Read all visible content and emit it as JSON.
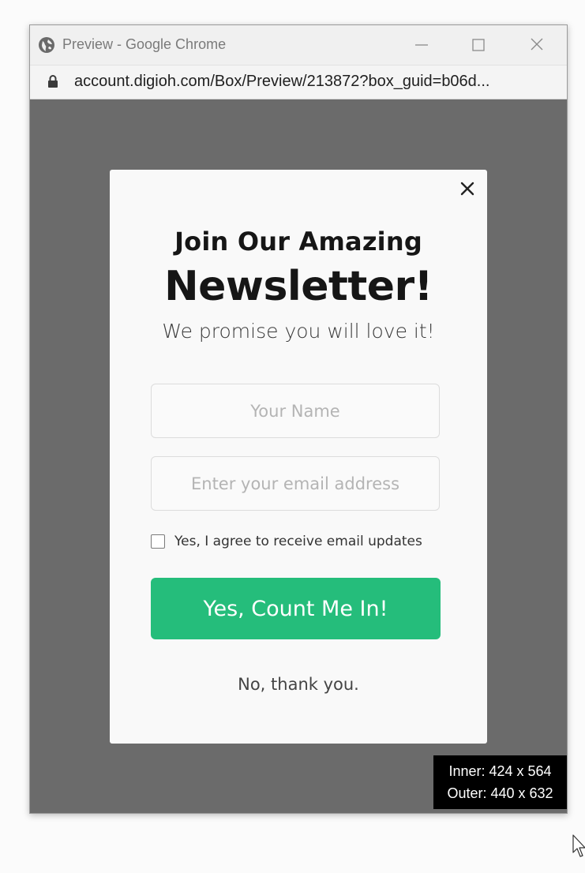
{
  "window": {
    "title": "Preview - Google Chrome",
    "title_icon": "globe-icon",
    "controls": [
      "minimize-icon",
      "maximize-icon",
      "close-icon"
    ]
  },
  "address_bar": {
    "url": "account.digioh.com/Box/Preview/213872?box_guid=b06d...",
    "icon": "lock-icon"
  },
  "modal": {
    "heading_line1": "Join Our Amazing",
    "heading_line2": "Newsletter!",
    "subtitle": "We promise you will love it!",
    "name_placeholder": "Your Name",
    "email_placeholder": "Enter your email address",
    "consent_label": "Yes, I agree to receive email updates",
    "consent_checked": false,
    "cta_label": "Yes, Count Me In!",
    "decline_label": "No, thank you.",
    "close_icon": "close-icon"
  },
  "size_overlay": {
    "inner": "Inner: 424 x 564",
    "outer": "Outer: 440 x 632"
  },
  "colors": {
    "backdrop": "#6b6b6b",
    "modal_bg": "#f9f9f9",
    "cta_bg": "#25bd7b",
    "cta_text": "#ffffff"
  }
}
